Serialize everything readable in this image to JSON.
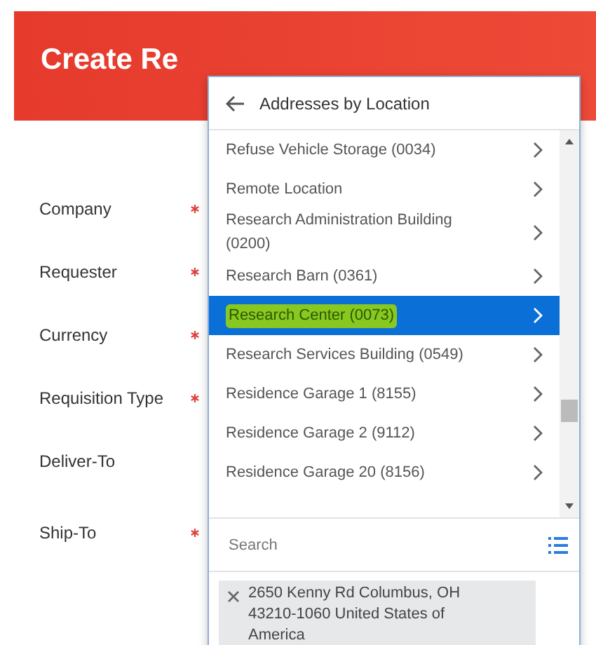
{
  "page": {
    "title": "Create Re"
  },
  "fields": [
    {
      "label": "Company",
      "required": true
    },
    {
      "label": "Requester",
      "required": true
    },
    {
      "label": "Currency",
      "required": true
    },
    {
      "label": "Requisition Type",
      "required": true
    },
    {
      "label": "Deliver-To",
      "required": false
    },
    {
      "label": "Ship-To",
      "required": true
    }
  ],
  "popup": {
    "title": "Addresses by Location",
    "items": [
      {
        "label": "Refuse Vehicle Storage (0034)",
        "selected": false
      },
      {
        "label": "Remote Location",
        "selected": false
      },
      {
        "label": "Research Administration Building (0200)",
        "selected": false
      },
      {
        "label": "Research Barn (0361)",
        "selected": false
      },
      {
        "label": "Research Center (0073)",
        "selected": true
      },
      {
        "label": "Research Services Building (0549)",
        "selected": false
      },
      {
        "label": "Residence Garage 1 (8155)",
        "selected": false
      },
      {
        "label": "Residence Garage 2 (9112)",
        "selected": false
      },
      {
        "label": "Residence Garage 20 (8156)",
        "selected": false
      }
    ],
    "search": {
      "placeholder": "Search"
    },
    "chip": {
      "text": "2650 Kenny Rd Columbus, OH 43210-1060 United States of America"
    }
  }
}
